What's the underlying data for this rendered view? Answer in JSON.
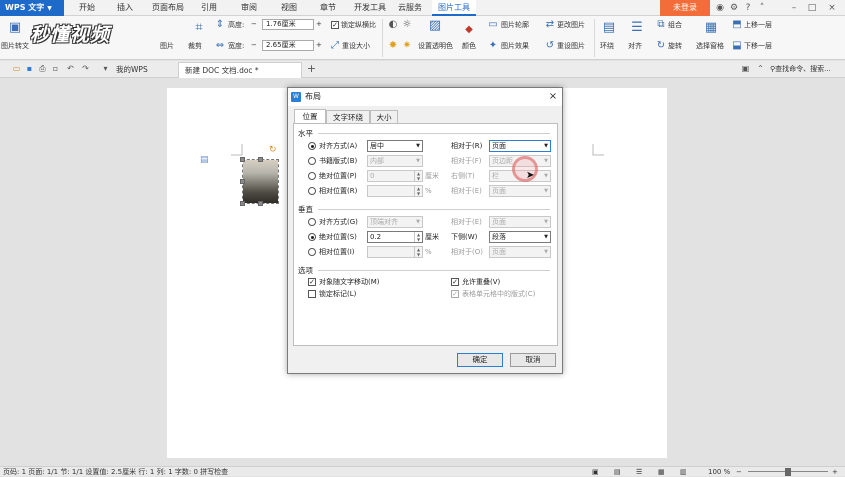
{
  "app": {
    "logo": "WPS 文字"
  },
  "menu": {
    "tabs": [
      "开始",
      "插入",
      "页面布局",
      "引用",
      "审阅",
      "视图",
      "章节",
      "开发工具",
      "云服务",
      "图片工具"
    ],
    "active_tab": "图片工具",
    "login": "未登录"
  },
  "ribbon": {
    "pic_to_text": "图片转文",
    "crop": "裁剪",
    "pic_label": "图片",
    "height_label": "高度:",
    "height_value": "1.76厘米",
    "width_label": "宽度:",
    "width_value": "2.65厘米",
    "lock_ratio": "锁定纵横比",
    "reset_size": "重设大小",
    "set_transparent": "设置透明色",
    "color": "颜色",
    "pic_outline": "图片轮廓",
    "pic_effect": "图片效果",
    "change_pic": "更改图片",
    "reset_pic": "重设图片",
    "wrap": "环绕",
    "align": "对齐",
    "group": "组合",
    "rotate": "旋转",
    "selection_pane": "选择窗格",
    "bring_forward": "上移一层",
    "send_backward": "下移一层",
    "watermark": "秒懂视频"
  },
  "tabbar": {
    "tab_mywps": "我的WPS",
    "tab_doc": "新建 DOC 文档.doc *",
    "add_tab": "+",
    "search": "查找命令、搜索..."
  },
  "dialog": {
    "title": "布局",
    "close": "×",
    "tabs": [
      "位置",
      "文字环绕",
      "大小"
    ],
    "horizontal": {
      "title": "水平",
      "align_label": "对齐方式(A)",
      "align_value": "居中",
      "rel_label": "相对于(R)",
      "rel_value": "页面",
      "book_label": "书籍版式(B)",
      "book_value": "内部",
      "book_rel_label": "相对于(F)",
      "book_rel_value": "页边距",
      "abs_label": "绝对位置(P)",
      "abs_value": "0",
      "abs_unit": "厘米",
      "right_label": "右侧(T)",
      "right_value": "栏",
      "relpos_label": "相对位置(R)",
      "relpos_unit": "%",
      "relpos_rel_label": "相对于(E)",
      "relpos_rel_value": "页面"
    },
    "vertical": {
      "title": "垂直",
      "align_label": "对齐方式(G)",
      "align_value": "顶端对齐",
      "rel_label": "相对于(E)",
      "rel_value": "页面",
      "abs_label": "绝对位置(S)",
      "abs_value": "0.2",
      "abs_unit": "厘米",
      "below_label": "下侧(W)",
      "below_value": "段落",
      "relpos_label": "相对位置(I)",
      "relpos_unit": "%",
      "relpos_rel_label": "相对于(O)",
      "relpos_rel_value": "页面"
    },
    "options": {
      "title": "选项",
      "move_with_text": "对象随文字移动(M)",
      "lock_anchor": "锁定标记(L)",
      "allow_overlap": "允许重叠(V)",
      "layout_in_cell": "表格单元格中的版式(C)"
    },
    "ok": "确定",
    "cancel": "取消"
  },
  "status": {
    "text": "页码: 1  页面: 1/1  节: 1/1  设置值: 2.5厘米  行: 1  列: 1  字数: 0  拼写检查",
    "zoom": "100 %"
  },
  "colors": {
    "accent": "#1e6ac9",
    "login": "#f26d3a",
    "dialog_focus": "#2a7fd4"
  }
}
